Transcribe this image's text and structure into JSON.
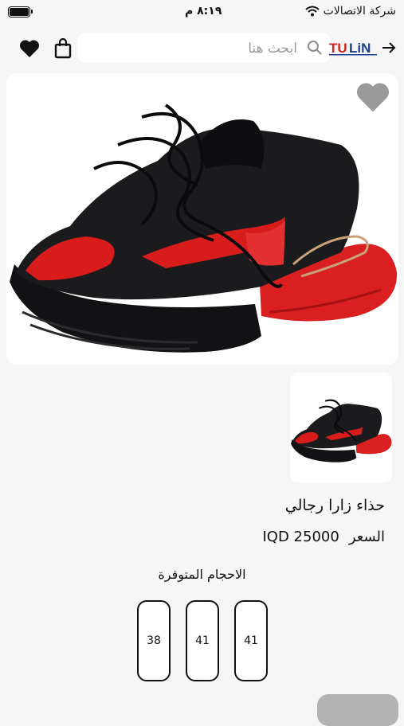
{
  "status_bar": {
    "carrier": "شركة الاتصالات",
    "time": "٨:١٩ م"
  },
  "header": {
    "search_placeholder": "ابحث هنا",
    "logo_text": "TULiN",
    "icons": [
      "back-arrow-icon",
      "search-icon",
      "shopping-bag-icon",
      "heart-icon"
    ]
  },
  "product": {
    "name": "حذاء زارا رجالي",
    "price_label": "السعر",
    "price_value": "IQD 25000",
    "sizes_title": "الاحجام المتوفرة",
    "sizes": [
      "41",
      "41",
      "38"
    ],
    "colors": {
      "shoe_body": "#1b1b1d",
      "shoe_accent": "#d81c1c",
      "fav_heart": "#9a9a9a"
    }
  }
}
